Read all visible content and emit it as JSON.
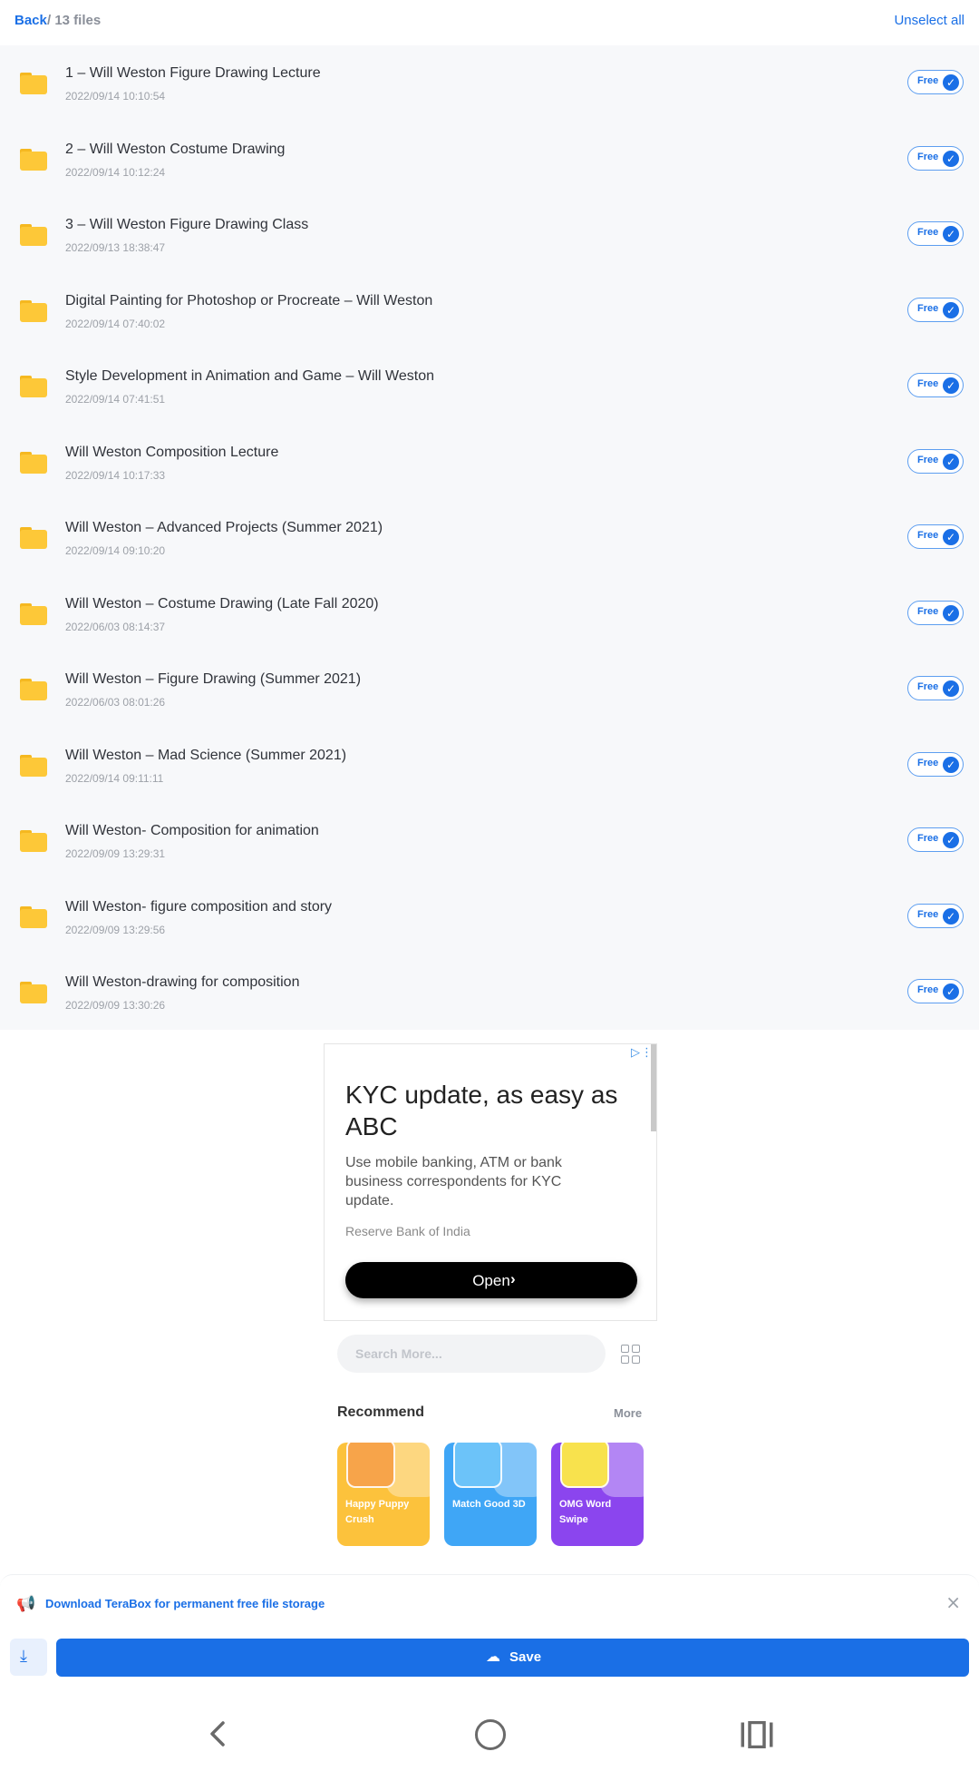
{
  "header": {
    "back_label": "Back",
    "crumb": "/ 13 files",
    "unselect_label": "Unselect all"
  },
  "files": [
    {
      "name": "1 – Will Weston Figure Drawing Lecture",
      "date": "2022/09/14 10:10:54",
      "badge": "Free"
    },
    {
      "name": "2 – Will Weston Costume Drawing",
      "date": "2022/09/14 10:12:24",
      "badge": "Free"
    },
    {
      "name": "3 – Will Weston Figure Drawing Class",
      "date": "2022/09/13 18:38:47",
      "badge": "Free"
    },
    {
      "name": "Digital Painting for Photoshop or Procreate – Will Weston",
      "date": "2022/09/14 07:40:02",
      "badge": "Free"
    },
    {
      "name": "Style Development in Animation and Game – Will Weston",
      "date": "2022/09/14 07:41:51",
      "badge": "Free"
    },
    {
      "name": "Will Weston Composition Lecture",
      "date": "2022/09/14 10:17:33",
      "badge": "Free"
    },
    {
      "name": "Will Weston – Advanced Projects (Summer 2021)",
      "date": "2022/09/14 09:10:20",
      "badge": "Free"
    },
    {
      "name": "Will Weston – Costume Drawing (Late Fall 2020)",
      "date": "2022/06/03 08:14:37",
      "badge": "Free"
    },
    {
      "name": "Will Weston – Figure Drawing (Summer 2021)",
      "date": "2022/06/03 08:01:26",
      "badge": "Free"
    },
    {
      "name": "Will Weston – Mad Science (Summer 2021)",
      "date": "2022/09/14 09:11:11",
      "badge": "Free"
    },
    {
      "name": "Will Weston- Composition for animation",
      "date": "2022/09/09 13:29:31",
      "badge": "Free"
    },
    {
      "name": "Will Weston- figure composition and story",
      "date": "2022/09/09 13:29:56",
      "badge": "Free"
    },
    {
      "name": "Will Weston-drawing for composition",
      "date": "2022/09/09 13:30:26",
      "badge": "Free"
    }
  ],
  "ad": {
    "title": "KYC update, as easy as ABC",
    "description": "Use mobile banking, ATM or bank business correspondents for KYC update.",
    "advertiser": "Reserve Bank of India",
    "cta": "Open"
  },
  "search": {
    "placeholder": "Search More..."
  },
  "recommend": {
    "title": "Recommend",
    "more_label": "More",
    "games": [
      {
        "name": "Happy Puppy Crush",
        "color": "#fcc23c"
      },
      {
        "name": "Match Good 3D",
        "color": "#3fa6f6"
      },
      {
        "name": "OMG Word Swipe",
        "color": "#8b45ee"
      }
    ]
  },
  "download_bar": {
    "promo_text": "Download TeraBox for permanent free file storage",
    "save_label": "Save"
  },
  "colors": {
    "accent": "#1a6fe6",
    "folder": "#fdc838"
  }
}
